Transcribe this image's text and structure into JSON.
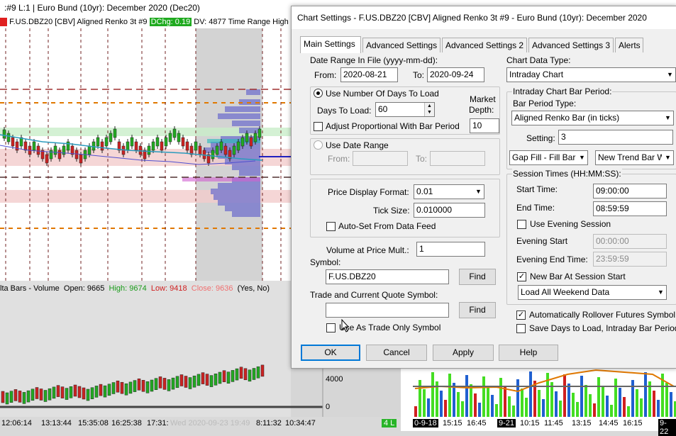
{
  "background_window": {
    "title": ":#9  L:1 | Euro Bund (10yr): December 2020 (Dec20)",
    "symbol_strip": "F.US.DBZ20 [CBV]  Aligned Renko 3t  #9",
    "dchg": "DChg: 0.19",
    "strip_rest": "DV: 4877 Time Range High",
    "indicator": {
      "prefix": "lta Bars - Volume",
      "open": "Open: 9665",
      "high": "High: 9674",
      "low": "Low: 9418",
      "close": "Close: 9636",
      "flags": "(Yes, No)"
    },
    "price_labels": [
      "4000",
      "0"
    ],
    "time_labels": [
      "12:06:14",
      "13:13:44",
      "15:35:08",
      "16:25:38",
      "17:31:",
      "Wed 2020-09-23  19:49",
      "8:11:32",
      "10:34:47"
    ],
    "status_badge": "4 L",
    "mini_time_labels": [
      "0-9-18",
      "15:15",
      "16:45",
      "9-21",
      "10:15",
      "11:45",
      "13:15",
      "14:45",
      "16:15",
      "9-22"
    ],
    "colors": {
      "up_bar": "#22aa22",
      "down_bar": "#cc2222",
      "zone_red": "#f2c4c4",
      "zone_green": "#c8ecc8",
      "profile": "#7070cc",
      "dash_orange": "#e07800"
    }
  },
  "dialog": {
    "title": "Chart Settings - F.US.DBZ20 [CBV]  Aligned Renko 3t  #9 - Euro Bund (10yr): December 2020",
    "tabs": [
      "Main Settings",
      "Advanced Settings",
      "Advanced Settings 2",
      "Advanced Settings 3",
      "Alerts"
    ],
    "active_tab": "Main Settings",
    "date_range_label": "Date Range In File (yyyy-mm-dd):",
    "from_label": "From:",
    "from_value": "2020-08-21",
    "to_label": "To:",
    "to_value": "2020-09-24",
    "use_days_label": "Use Number Of Days To Load",
    "days_to_load_label": "Days To Load:",
    "days_to_load_value": "60",
    "market_depth_label_1": "Market",
    "market_depth_label_2": "Depth:",
    "market_depth_value": "10",
    "adjust_prop_label": "Adjust Proportional With Bar Period",
    "use_date_range_label": "Use Date Range",
    "dr_from_label": "From:",
    "dr_to_label": "To:",
    "price_format_label": "Price Display Format:",
    "price_format_value": "0.01",
    "tick_size_label": "Tick Size:",
    "tick_size_value": "0.010000",
    "auto_set_label": "Auto-Set From Data Feed",
    "vol_price_mult_label": "Volume at Price Mult.:",
    "vol_price_mult_value": "1",
    "symbol_label": "Symbol:",
    "symbol_value": "F.US.DBZ20",
    "find_label": "Find",
    "trade_symbol_label": "Trade and Current Quote Symbol:",
    "trade_symbol_value": "",
    "find2_label": "Find",
    "use_trade_only_label": "Use As Trade Only Symbol",
    "chart_data_type_label": "Chart Data Type:",
    "chart_data_type_value": "Intraday Chart",
    "intraday_period_label": "Intraday Chart Bar Period:",
    "bar_period_type_label": "Bar Period Type:",
    "bar_period_type_value": "Aligned Renko Bar (in ticks)",
    "setting_label": "Setting:",
    "setting_value": "3",
    "gap_fill_value": "Gap Fill - Fill Bar",
    "new_trend_value": "New Trend Bar W",
    "session_times_label": "Session Times (HH:MM:SS):",
    "start_time_label": "Start Time:",
    "start_time_value": "09:00:00",
    "end_time_label": "End Time:",
    "end_time_value": "08:59:59",
    "use_evening_label": "Use Evening Session",
    "evening_start_label": "Evening Start",
    "evening_start_value": "00:00:00",
    "evening_end_label": "Evening End Time:",
    "evening_end_value": "23:59:59",
    "new_bar_session_label": "New Bar At Session Start",
    "weekend_value": "Load All Weekend Data",
    "auto_rollover_label": "Automatically Rollover Futures Symbol",
    "save_days_label": "Save Days to Load, Intraday Bar Period",
    "ok_label": "OK",
    "cancel_label": "Cancel",
    "apply_label": "Apply",
    "help_label": "Help"
  }
}
